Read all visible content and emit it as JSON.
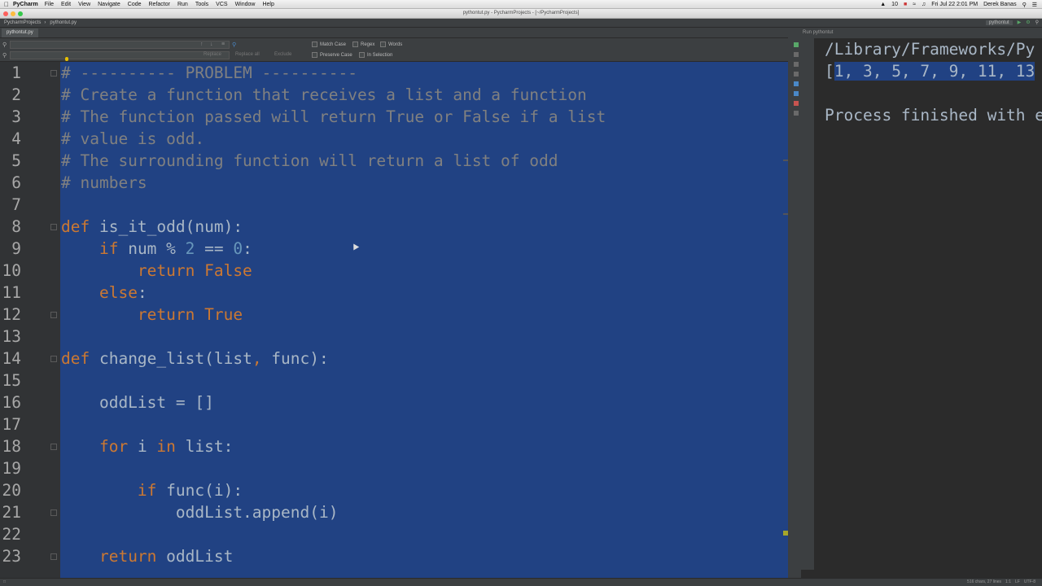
{
  "menubar": {
    "app_name": "PyCharm",
    "items": [
      "File",
      "Edit",
      "View",
      "Navigate",
      "Code",
      "Refactor",
      "Run",
      "Tools",
      "VCS",
      "Window",
      "Help"
    ],
    "status": {
      "battery": "10",
      "datetime": "Fri Jul 22  2:01 PM",
      "user": "Derek Banas"
    }
  },
  "window": {
    "title": "pythontut.py - PycharmProjects - [~/PycharmProjects]"
  },
  "navbar": {
    "breadcrumbs": [
      "PycharmProjects",
      "pythontut.py"
    ],
    "run_config": "pythontut"
  },
  "editor_tab": {
    "label": "pythontut.py"
  },
  "find_bar": {
    "search_value": "",
    "replace_value": "",
    "match_case": "Match Case",
    "regex": "Regex",
    "words": "Words",
    "preserve_case": "Preserve Case",
    "in_selection": "In Selection",
    "replace": "Replace",
    "replace_all": "Replace all",
    "exclude": "Exclude"
  },
  "code_lines": [
    {
      "n": "1",
      "tokens": [
        [
          "comment",
          "# ---------- PROBLEM ----------"
        ]
      ]
    },
    {
      "n": "2",
      "tokens": [
        [
          "comment",
          "# Create a function that receives a list and a function"
        ]
      ]
    },
    {
      "n": "3",
      "tokens": [
        [
          "comment",
          "# The function passed will return True or False if a list"
        ]
      ]
    },
    {
      "n": "4",
      "tokens": [
        [
          "comment",
          "# value is odd."
        ]
      ]
    },
    {
      "n": "5",
      "tokens": [
        [
          "comment",
          "# The surrounding function will return a list of odd"
        ]
      ]
    },
    {
      "n": "6",
      "tokens": [
        [
          "comment",
          "# numbers"
        ]
      ]
    },
    {
      "n": "7",
      "tokens": []
    },
    {
      "n": "8",
      "tokens": [
        [
          "kw",
          "def "
        ],
        [
          "fn",
          "is_it_odd"
        ],
        [
          "plain",
          "(num):"
        ]
      ]
    },
    {
      "n": "9",
      "tokens": [
        [
          "plain",
          "    "
        ],
        [
          "kw",
          "if "
        ],
        [
          "plain",
          "num % "
        ],
        [
          "num",
          "2"
        ],
        [
          "plain",
          " == "
        ],
        [
          "num",
          "0"
        ],
        [
          "plain",
          ":"
        ]
      ]
    },
    {
      "n": "10",
      "tokens": [
        [
          "plain",
          "        "
        ],
        [
          "kw",
          "return False"
        ]
      ]
    },
    {
      "n": "11",
      "tokens": [
        [
          "plain",
          "    "
        ],
        [
          "kw",
          "else"
        ],
        [
          "plain",
          ":"
        ]
      ]
    },
    {
      "n": "12",
      "tokens": [
        [
          "plain",
          "        "
        ],
        [
          "kw",
          "return True"
        ]
      ]
    },
    {
      "n": "13",
      "tokens": []
    },
    {
      "n": "14",
      "tokens": [
        [
          "kw",
          "def "
        ],
        [
          "fn",
          "change_list"
        ],
        [
          "plain",
          "(list"
        ],
        [
          "kw",
          ", "
        ],
        [
          "plain",
          "func):"
        ]
      ]
    },
    {
      "n": "15",
      "tokens": []
    },
    {
      "n": "16",
      "tokens": [
        [
          "plain",
          "    oddList = []"
        ]
      ]
    },
    {
      "n": "17",
      "tokens": []
    },
    {
      "n": "18",
      "tokens": [
        [
          "plain",
          "    "
        ],
        [
          "kw",
          "for "
        ],
        [
          "plain",
          "i "
        ],
        [
          "kw",
          "in "
        ],
        [
          "plain",
          "list:"
        ]
      ]
    },
    {
      "n": "19",
      "tokens": []
    },
    {
      "n": "20",
      "tokens": [
        [
          "plain",
          "        "
        ],
        [
          "kw",
          "if "
        ],
        [
          "plain",
          "func(i):"
        ]
      ]
    },
    {
      "n": "21",
      "tokens": [
        [
          "plain",
          "            oddList.append(i)"
        ]
      ]
    },
    {
      "n": "22",
      "tokens": []
    },
    {
      "n": "23",
      "tokens": [
        [
          "plain",
          "    "
        ],
        [
          "kw",
          "return "
        ],
        [
          "plain",
          "oddList"
        ]
      ]
    }
  ],
  "run_panel": {
    "header": "Run  pythontut",
    "lines": [
      {
        "text": "/Library/Frameworks/Py",
        "selected_prefix": "",
        "selected": "",
        "rest": "/Library/Frameworks/Py"
      },
      {
        "text": "[1, 3, 5, 7, 9, 11, 13",
        "selected_prefix": "[",
        "selected": "1, 3, 5, 7, 9, 11, 13",
        "rest": ""
      },
      {
        "text": "",
        "selected_prefix": "",
        "selected": "",
        "rest": ""
      },
      {
        "text": "Process finished with e",
        "selected_prefix": "",
        "selected": "",
        "rest": "Process finished with e"
      }
    ]
  },
  "statusbar": {
    "position": "516 chars, 27 lines",
    "caret": "1:1",
    "line_sep": "LF",
    "encoding": "UTF-8"
  },
  "colors": {
    "selection": "#214283",
    "keyword": "#cc7832",
    "comment": "#808080",
    "number": "#6897bb",
    "text": "#a9b7c6",
    "background": "#2b2b2b"
  }
}
